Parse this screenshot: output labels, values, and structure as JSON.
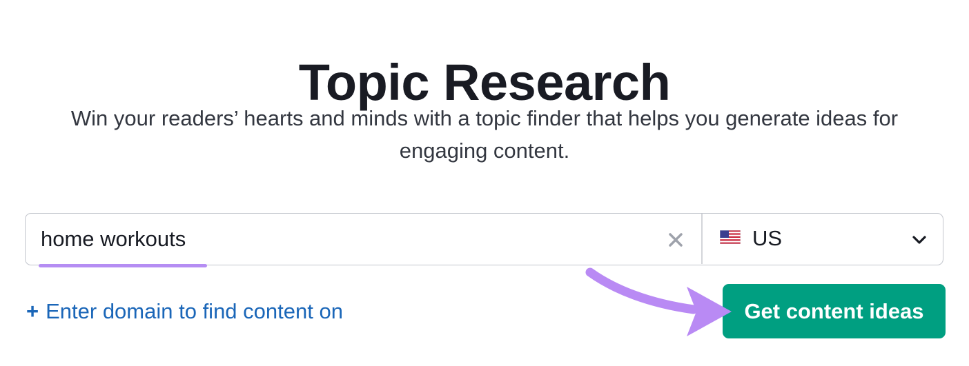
{
  "header": {
    "title": "Topic Research",
    "subtitle": "Win your readers’ hearts and minds with a topic finder that helps you generate ideas for engaging content."
  },
  "search": {
    "value": "home workouts",
    "clear_icon": "close-icon"
  },
  "country": {
    "flag_icon": "us-flag-icon",
    "selected": "US",
    "chevron_icon": "chevron-down-icon"
  },
  "domain_link": {
    "icon": "plus-icon",
    "plus": "+",
    "label": "Enter domain to find content on"
  },
  "cta": {
    "label": "Get content ideas"
  },
  "colors": {
    "accent_underline": "#b58df3",
    "annotation_arrow": "#b98af4",
    "button_bg": "#009f81",
    "link": "#1a66b8",
    "title": "#191b23"
  }
}
